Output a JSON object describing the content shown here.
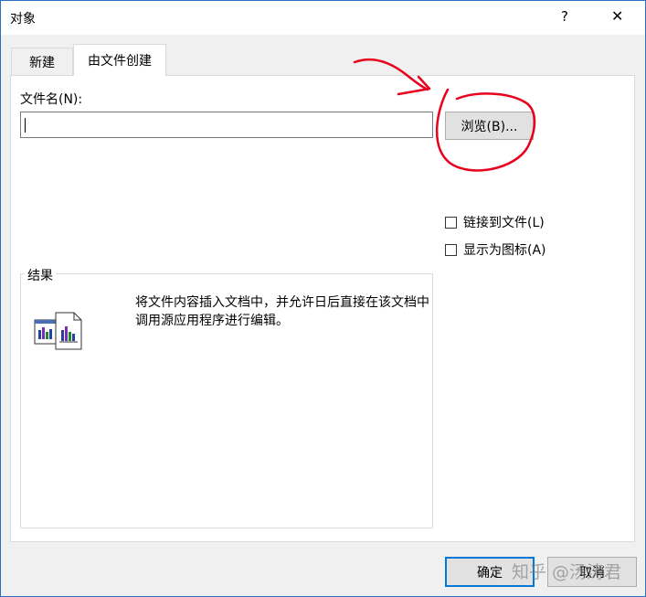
{
  "window": {
    "title": "对象",
    "help_label": "?",
    "close_label": "✕"
  },
  "tabs": [
    {
      "label": "新建",
      "active": false
    },
    {
      "label": "由文件创建",
      "active": true
    }
  ],
  "filename": {
    "label": "文件名(N):",
    "value": ""
  },
  "browse_button": {
    "label": "浏览(B)..."
  },
  "options": {
    "link_to_file": {
      "label": "链接到文件(L)",
      "checked": false
    },
    "display_as_icon": {
      "label": "显示为图标(A)",
      "checked": false
    }
  },
  "result": {
    "title": "结果",
    "description": "将文件内容插入文档中，并允许日后直接在该文档中调用源应用程序进行编辑。",
    "icon": "embedded-document-icon"
  },
  "buttons": {
    "ok": "确定",
    "cancel": "取消"
  },
  "watermark": "知乎 @汤涛君",
  "colors": {
    "accent": "#0078d7",
    "annotation": "#e8001c",
    "dialog_bg": "#f0f0f0"
  }
}
